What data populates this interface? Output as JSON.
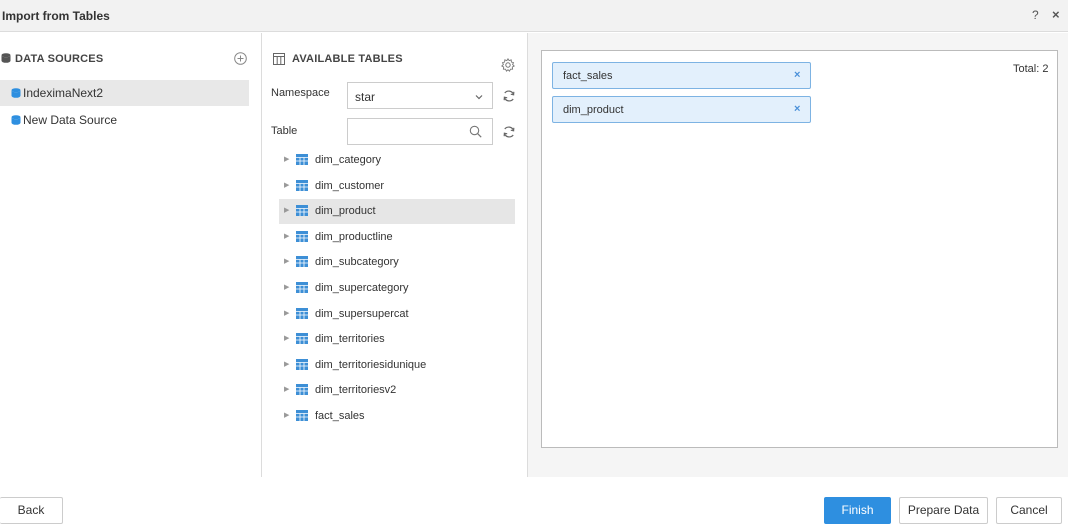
{
  "window": {
    "title": "Import from Tables",
    "help_label": "?",
    "close_label": "×"
  },
  "data_sources": {
    "heading": "DATA SOURCES",
    "items": [
      {
        "label": "IndeximaNext2",
        "selected": true
      },
      {
        "label": "New Data Source",
        "selected": false
      }
    ]
  },
  "available_tables": {
    "heading": "AVAILABLE TABLES",
    "namespace_label": "Namespace",
    "namespace_value": "star",
    "table_label": "Table",
    "table_value": "",
    "tables": [
      {
        "label": "dim_category",
        "selected": false
      },
      {
        "label": "dim_customer",
        "selected": false
      },
      {
        "label": "dim_product",
        "selected": true
      },
      {
        "label": "dim_productline",
        "selected": false
      },
      {
        "label": "dim_subcategory",
        "selected": false
      },
      {
        "label": "dim_supercategory",
        "selected": false
      },
      {
        "label": "dim_supersupercat",
        "selected": false
      },
      {
        "label": "dim_territories",
        "selected": false
      },
      {
        "label": "dim_territoriesidunique",
        "selected": false
      },
      {
        "label": "dim_territoriesv2",
        "selected": false
      },
      {
        "label": "fact_sales",
        "selected": false
      }
    ]
  },
  "selected_tables": {
    "total_label": "Total: 2",
    "items": [
      {
        "label": "fact_sales",
        "remove": "×"
      },
      {
        "label": "dim_product",
        "remove": "×"
      }
    ]
  },
  "footer": {
    "back_label": "Back",
    "finish_label": "Finish",
    "prepare_label": "Prepare Data",
    "cancel_label": "Cancel"
  },
  "colors": {
    "accent": "#2e8fe0",
    "chip_bg": "#e3f0fc",
    "chip_border": "#7db3e3",
    "db_icon": "#2e8fe0",
    "table_icon": "#3d8fd6"
  },
  "icons": {
    "data_sources": "database-icon",
    "add": "add-circle-icon",
    "tables": "table-icon",
    "settings": "gear-icon",
    "refresh": "refresh-icon",
    "search": "search-icon",
    "expand": "triangle-right-icon"
  }
}
